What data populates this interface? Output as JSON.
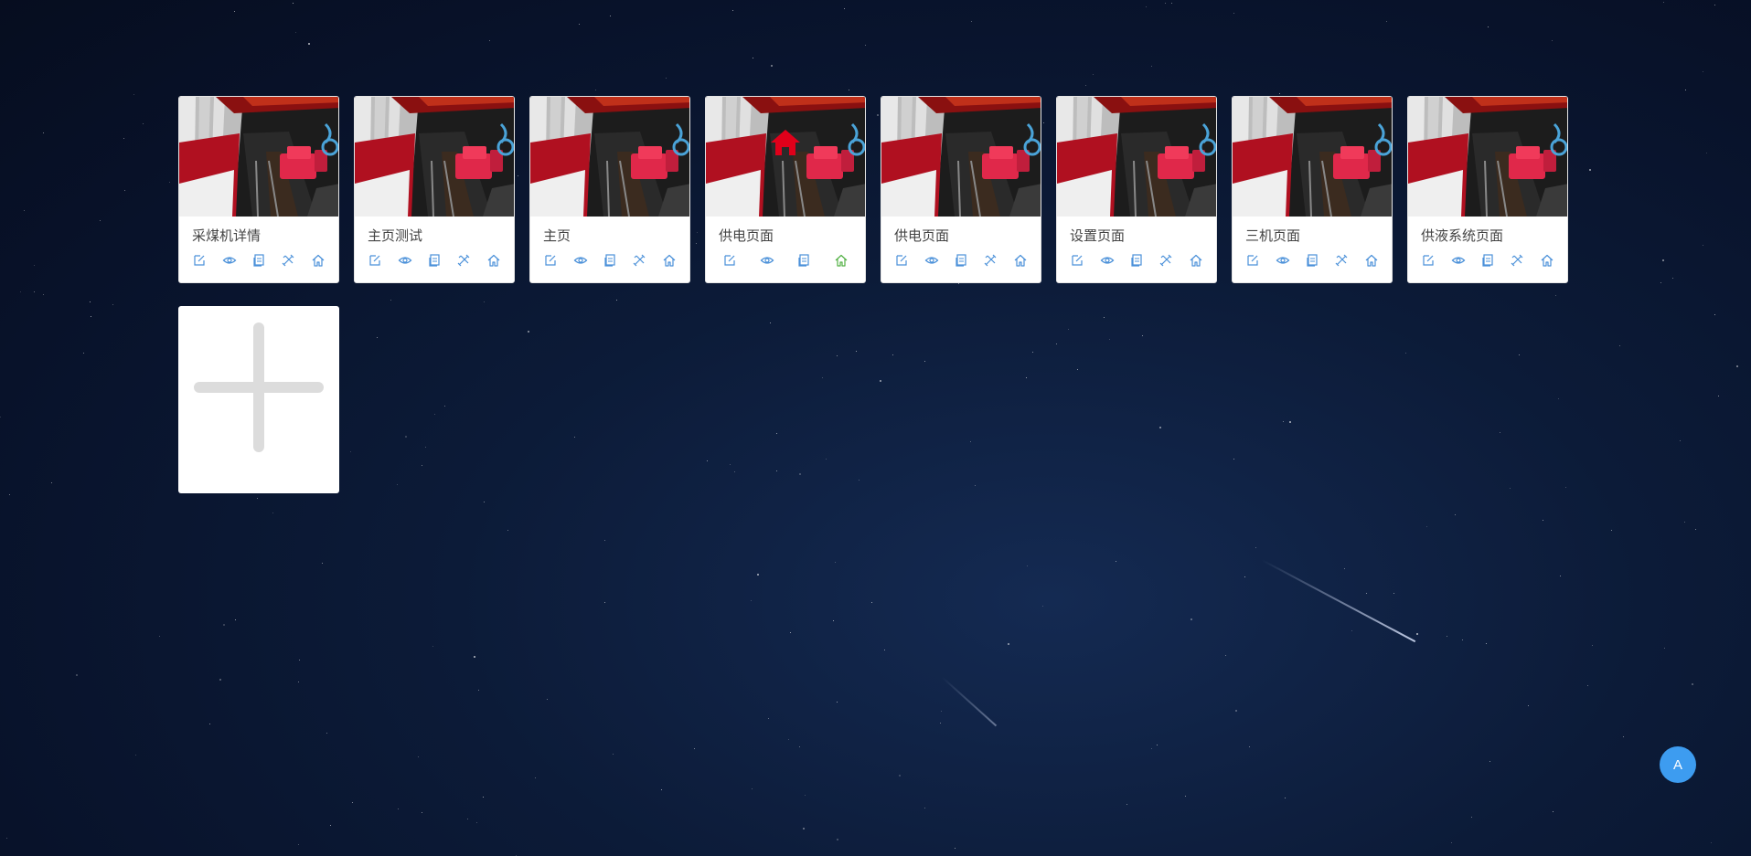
{
  "colors": {
    "action_icon": "#4a90d9",
    "home_active": "#52b044",
    "home_badge": "#e0001a",
    "avatar_bg": "#3d9cf0"
  },
  "cards": [
    {
      "title": "采煤机详情",
      "is_home": false,
      "actions": [
        "edit-icon",
        "eye-icon",
        "copy-icon",
        "tools-icon",
        "home-icon"
      ]
    },
    {
      "title": "主页测试",
      "is_home": false,
      "actions": [
        "edit-icon",
        "eye-icon",
        "copy-icon",
        "tools-icon",
        "home-icon"
      ]
    },
    {
      "title": "主页",
      "is_home": false,
      "actions": [
        "edit-icon",
        "eye-icon",
        "copy-icon",
        "tools-icon",
        "home-icon"
      ]
    },
    {
      "title": "供电页面",
      "is_home": true,
      "actions": [
        "edit-icon",
        "eye-icon",
        "copy-icon",
        "home-icon"
      ]
    },
    {
      "title": "供电页面",
      "is_home": false,
      "actions": [
        "edit-icon",
        "eye-icon",
        "copy-icon",
        "tools-icon",
        "home-icon"
      ]
    },
    {
      "title": "设置页面",
      "is_home": false,
      "actions": [
        "edit-icon",
        "eye-icon",
        "copy-icon",
        "tools-icon",
        "home-icon"
      ]
    },
    {
      "title": "三机页面",
      "is_home": false,
      "actions": [
        "edit-icon",
        "eye-icon",
        "copy-icon",
        "tools-icon",
        "home-icon"
      ]
    },
    {
      "title": "供液系统页面",
      "is_home": false,
      "actions": [
        "edit-icon",
        "eye-icon",
        "copy-icon",
        "tools-icon",
        "home-icon"
      ]
    }
  ],
  "add_card": {
    "icon": "plus-icon"
  },
  "user": {
    "avatar_letter": "A"
  }
}
